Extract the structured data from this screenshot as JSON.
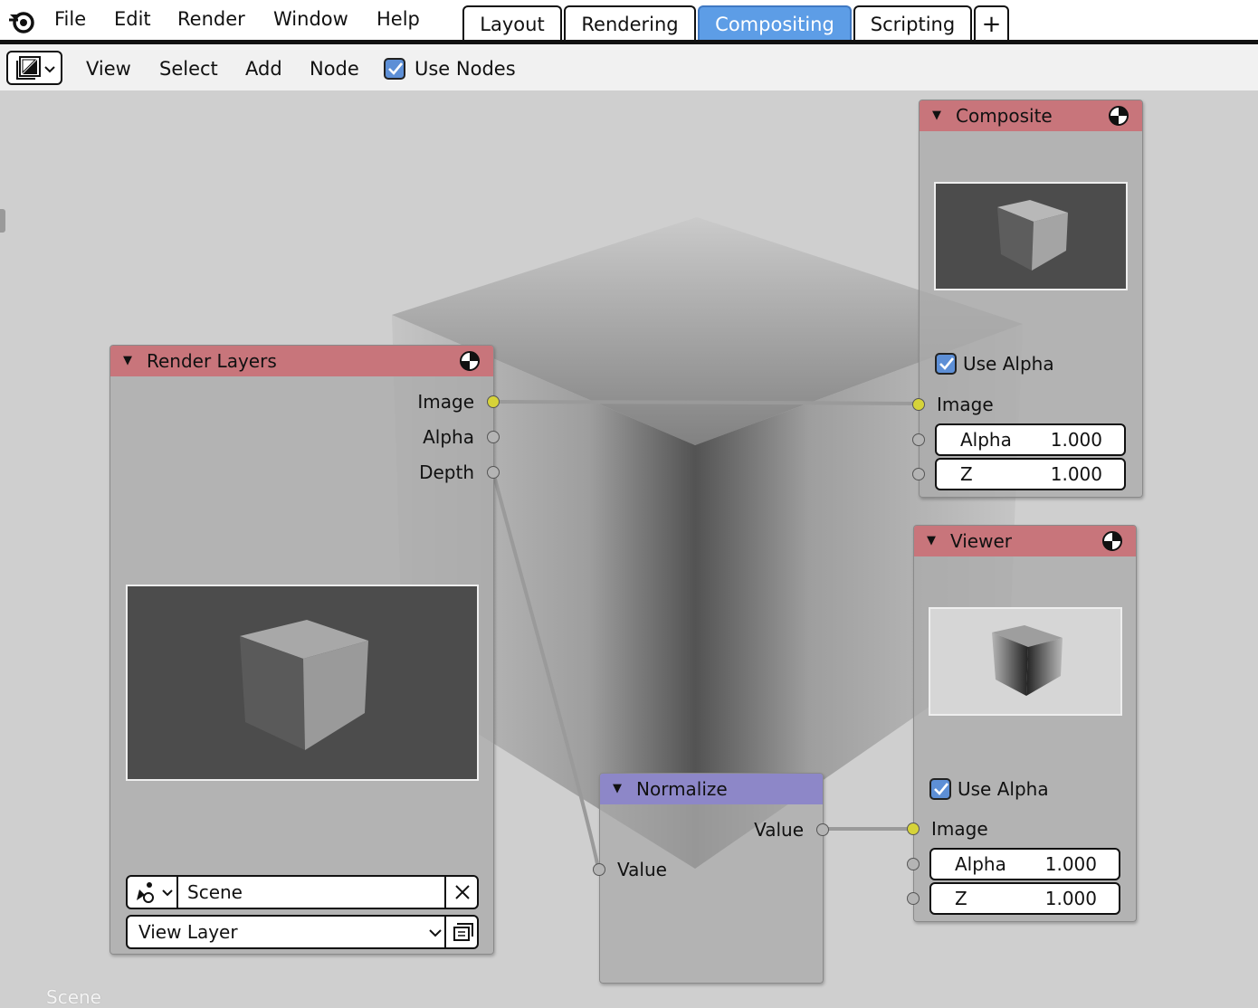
{
  "topbar": {
    "menu": [
      "File",
      "Edit",
      "Render",
      "Window",
      "Help"
    ],
    "workspaces": [
      {
        "label": "Layout",
        "active": false
      },
      {
        "label": "Rendering",
        "active": false
      },
      {
        "label": "Compositing",
        "active": true
      },
      {
        "label": "Scripting",
        "active": false
      }
    ],
    "add_tab": "+"
  },
  "header": {
    "menu": [
      "View",
      "Select",
      "Add",
      "Node"
    ],
    "use_nodes_label": "Use Nodes",
    "use_nodes_checked": true
  },
  "canvas": {
    "scene_label": "Scene"
  },
  "nodes": {
    "render_layers": {
      "title": "Render Layers",
      "outputs": [
        "Image",
        "Alpha",
        "Depth"
      ],
      "scene": "Scene",
      "view_layer": "View Layer"
    },
    "normalize": {
      "title": "Normalize",
      "output": "Value",
      "input": "Value"
    },
    "composite": {
      "title": "Composite",
      "use_alpha_label": "Use Alpha",
      "use_alpha": true,
      "inputs": {
        "image": "Image",
        "alpha_label": "Alpha",
        "alpha_value": "1.000",
        "z_label": "Z",
        "z_value": "1.000"
      }
    },
    "viewer": {
      "title": "Viewer",
      "use_alpha_label": "Use Alpha",
      "use_alpha": true,
      "inputs": {
        "image": "Image",
        "alpha_label": "Alpha",
        "alpha_value": "1.000",
        "z_label": "Z",
        "z_value": "1.000"
      }
    }
  },
  "colors": {
    "accent": "#5d9de6",
    "node_header_output": "#c8757b",
    "node_header_converter": "#8d87c8",
    "socket_color": "#d6d339"
  }
}
